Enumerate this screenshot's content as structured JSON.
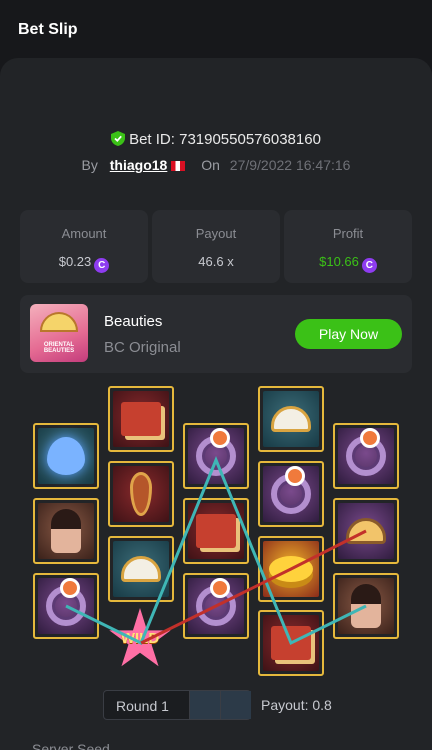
{
  "header": {
    "title": "Bet Slip"
  },
  "bet": {
    "id_label": "Bet ID: 73190550576038160",
    "by_label": "By",
    "user": "thiago18",
    "on_label": "On",
    "date": "27/9/2022 16:47:16"
  },
  "stats": [
    {
      "label": "Amount",
      "value": "$0.23",
      "color": "#c7c9cf"
    },
    {
      "label": "Payout",
      "value": "46.6 x",
      "color": "#c7c9cf"
    },
    {
      "label": "Profit",
      "value": "$10.66",
      "color": "#3bc117"
    }
  ],
  "game": {
    "name": "Beauties",
    "provider": "BC Original",
    "play_label": "Play Now",
    "thumb_text": "ORIENTAL BEAUTIES"
  },
  "reels": {
    "wild_label": "WILD",
    "symbols": [
      "lotus",
      "book",
      "ring",
      "fan",
      "ring",
      "lady",
      "pipa",
      "ring",
      "ring",
      "comb",
      "ring",
      "fan",
      "book",
      "gold",
      "lady",
      "wild",
      "ring",
      "book"
    ]
  },
  "round": {
    "label": "Round 1",
    "payout_label": "Payout: 0.8"
  },
  "footer": {
    "seed_label": "Server Seed"
  },
  "colors": {
    "accent": "#3bc117",
    "coin": "#8e3cf0",
    "frame": "#e5b83c",
    "line_teal": "#3fb6b6",
    "line_red": "#c2302a"
  }
}
